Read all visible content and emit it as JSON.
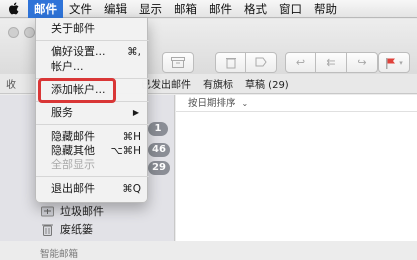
{
  "menubar": {
    "apple_icon": "apple-logo-icon",
    "items": [
      {
        "label": "邮件"
      },
      {
        "label": "文件"
      },
      {
        "label": "编辑"
      },
      {
        "label": "显示"
      },
      {
        "label": "邮箱"
      },
      {
        "label": "邮件"
      },
      {
        "label": "格式"
      },
      {
        "label": "窗口"
      },
      {
        "label": "帮助"
      }
    ]
  },
  "mail_menu": {
    "about": "关于邮件",
    "preferences": "偏好设置...",
    "preferences_shortcut": "⌘,",
    "accounts": "帐户...",
    "add_account": "添加帐户...",
    "services": "服务",
    "hide_mail": "隐藏邮件",
    "hide_mail_shortcut": "⌘H",
    "hide_others": "隐藏其他",
    "hide_others_shortcut": "⌥⌘H",
    "show_all": "全部显示",
    "quit": "退出邮件",
    "quit_shortcut": "⌘Q"
  },
  "favorites_bar": {
    "partial_left": "收",
    "items": [
      "已发出邮件",
      "有旗标",
      "草稿 (29)"
    ]
  },
  "sidebar": {
    "badges": [
      "1",
      "46",
      "29"
    ],
    "junk": "垃圾邮件",
    "trash": "废纸篓",
    "smart_mailboxes": "智能邮箱"
  },
  "message_list": {
    "sort_label": "按日期排序"
  },
  "colors": {
    "menu_highlight": "#2e73d8",
    "annotation_box": "#d93636",
    "flag": "#e0413a"
  }
}
